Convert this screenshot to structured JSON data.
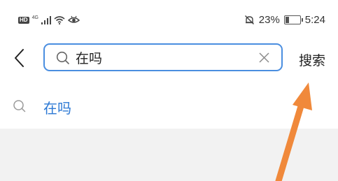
{
  "status_bar": {
    "hd": "HD",
    "network": "4G",
    "battery_percent": "23%",
    "battery_level": 0.23,
    "time": "5:24",
    "icons": [
      "hd-icon",
      "signal-icon",
      "wifi-icon",
      "eye-icon",
      "mute-bell-icon",
      "battery-icon"
    ]
  },
  "search": {
    "query": "在吗",
    "submit_label": "搜索"
  },
  "suggestions": [
    {
      "text": "在吗",
      "icon": "search-icon"
    }
  ],
  "colors": {
    "accent": "#2b78d4",
    "input_border": "#4a8ee0",
    "annotation_arrow": "#f0893b",
    "panel_gray": "#f2f2f2"
  }
}
